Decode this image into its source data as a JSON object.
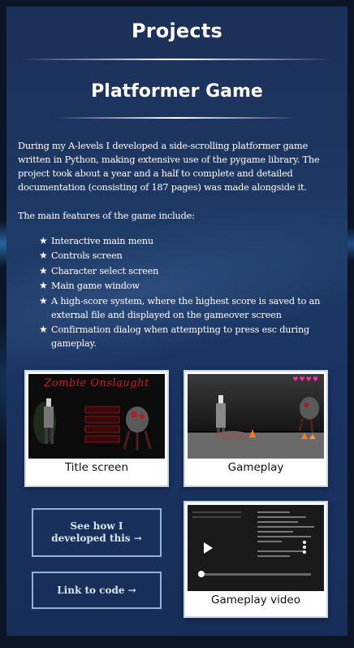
{
  "page": {
    "title": "Projects",
    "project_title": "Platformer Game",
    "description": "During my A-levels I developed a side-scrolling platformer game written in Python, making extensive use of the pygame library. The project took about a year and a half to complete and detailed documentation (consisting of 187 pages) was made alongside it.",
    "features_intro": "The main features of the game include:",
    "features": [
      "Interactive main menu",
      "Controls screen",
      "Character select screen",
      "Main game window",
      "A high-score system, where the highest score is saved to an external file and displayed on the gameover screen",
      "Confirmation dialog when attempting to press esc during gameplay."
    ],
    "bullet_icon": "star-icon"
  },
  "gallery": {
    "title_screen": {
      "caption": "Title screen",
      "image_text": "Zombie Onslaught"
    },
    "gameplay": {
      "caption": "Gameplay"
    },
    "video": {
      "caption": "Gameplay video",
      "progress": 0
    }
  },
  "buttons": {
    "how_developed": "See how I developed this →",
    "link_code": "Link to code →"
  },
  "colors": {
    "panel": "#1e3a66",
    "button_border": "#8fb3d9",
    "title_red": "#c0231f",
    "heart_pink": "#ff2aa5"
  }
}
